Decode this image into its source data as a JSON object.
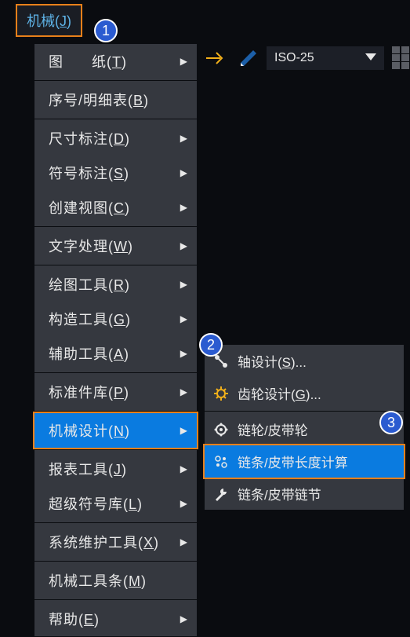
{
  "menubar": {
    "title_pre": "机械(",
    "title_u": "J",
    "title_post": ")"
  },
  "toolbar": {
    "iso_label": "ISO-25"
  },
  "badges": {
    "b1": "1",
    "b2": "2",
    "b3": "3"
  },
  "main_menu": {
    "items": [
      {
        "pre": "图",
        "spc": true,
        "mid": "纸(",
        "u": "T",
        "post": ")",
        "arrow": true
      },
      {
        "pre": "序号/明细表(",
        "u": "B",
        "post": ")",
        "arrow": false
      },
      {
        "pre": "尺寸标注(",
        "u": "D",
        "post": ")",
        "arrow": true
      },
      {
        "pre": "符号标注(",
        "u": "S",
        "post": ")",
        "arrow": true
      },
      {
        "pre": "创建视图(",
        "u": "C",
        "post": ")",
        "arrow": true
      },
      {
        "pre": "文字处理(",
        "u": "W",
        "post": ")",
        "arrow": true
      },
      {
        "pre": "绘图工具(",
        "u": "R",
        "post": ")",
        "arrow": true
      },
      {
        "pre": "构造工具(",
        "u": "G",
        "post": ")",
        "arrow": true
      },
      {
        "pre": "辅助工具(",
        "u": "A",
        "post": ")",
        "arrow": true
      },
      {
        "pre": "标准件库(",
        "u": "P",
        "post": ")",
        "arrow": true
      },
      {
        "pre": "机械设计(",
        "u": "N",
        "post": ")",
        "arrow": true,
        "hl": true,
        "name": "mechanical-design"
      },
      {
        "pre": "报表工具(",
        "u": "J",
        "post": ")",
        "arrow": true
      },
      {
        "pre": "超级符号库(",
        "u": "L",
        "post": ")",
        "arrow": true
      },
      {
        "pre": "系统维护工具(",
        "u": "X",
        "post": ")",
        "arrow": true
      },
      {
        "pre": "机械工具条(",
        "u": "M",
        "post": ")",
        "arrow": false
      },
      {
        "pre": "帮助(",
        "u": "E",
        "post": ")",
        "arrow": true
      }
    ],
    "separators_after": [
      0,
      1,
      4,
      5,
      8,
      9,
      10,
      12,
      13,
      14
    ]
  },
  "sub_menu": {
    "items": [
      {
        "pre": "轴设计(",
        "u": "S",
        "post": ")...",
        "icon": "shaft",
        "name": "shaft-design"
      },
      {
        "pre": "齿轮设计(",
        "u": "G",
        "post": ")...",
        "icon": "gear",
        "name": "gear-design"
      },
      {
        "pre": "链轮/皮带轮",
        "u": "",
        "post": "",
        "icon": "sprocket",
        "name": "sprocket-pulley"
      },
      {
        "pre": "链条/皮带长度计算",
        "u": "",
        "post": "",
        "icon": "chain",
        "name": "chain-belt-length",
        "hl": true
      },
      {
        "pre": "链条/皮带链节",
        "u": "",
        "post": "",
        "icon": "wrench",
        "name": "chain-belt-link"
      }
    ]
  }
}
